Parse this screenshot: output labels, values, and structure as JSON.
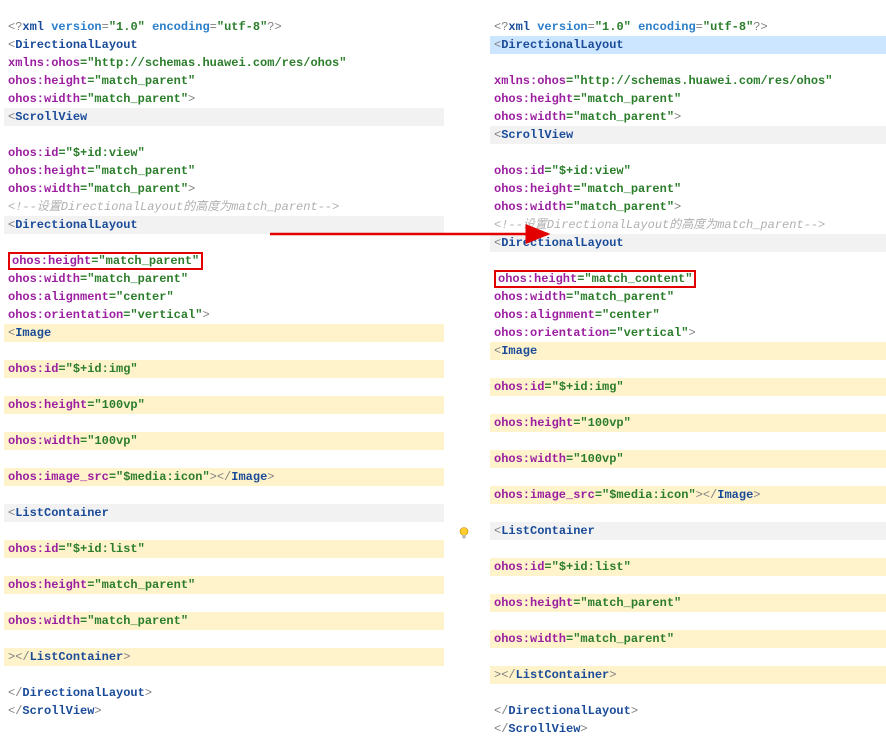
{
  "left": {
    "xml_decl": {
      "p1": "<?",
      "kw": "xml",
      "a1": "version",
      "v1": "\"1.0\"",
      "a2": "encoding",
      "v2": "\"utf-8\"",
      "p2": "?>"
    },
    "dl_open": {
      "lt": "<",
      "name": "DirectionalLayout"
    },
    "xmlns": {
      "a": "xmlns:ohos",
      "eq": "=",
      "v": "\"http://schemas.huawei.com/res/ohos\""
    },
    "height": {
      "a": "ohos:height",
      "eq": "=",
      "v": "\"match_parent\""
    },
    "width": {
      "a": "ohos:width",
      "eq": "=",
      "v": "\"match_parent\"",
      "gt": ">"
    },
    "sv_open": {
      "lt": "<",
      "name": "ScrollView"
    },
    "sv_id": {
      "a": "ohos:id",
      "eq": "=",
      "v": "\"$+id:view\""
    },
    "sv_h": {
      "a": "ohos:height",
      "eq": "=",
      "v": "\"match_parent\""
    },
    "sv_w": {
      "a": "ohos:width",
      "eq": "=",
      "v": "\"match_parent\"",
      "gt": ">"
    },
    "comment": "<!--设置DirectionalLayout的高度为match_parent-->",
    "dl2_open": {
      "lt": "<",
      "name": "DirectionalLayout"
    },
    "dl2_h_boxed": {
      "a": "ohos:height",
      "eq": "=",
      "v": "\"match_parent\""
    },
    "dl2_w": {
      "a": "ohos:width",
      "eq": "=",
      "v": "\"match_parent\""
    },
    "dl2_align": {
      "a": "ohos:alignment",
      "eq": "=",
      "v": "\"center\""
    },
    "dl2_orient": {
      "a": "ohos:orientation",
      "eq": "=",
      "v": "\"vertical\"",
      "gt": ">"
    },
    "img_open": {
      "lt": "<",
      "name": "Image"
    },
    "img_id": {
      "a": "ohos:id",
      "eq": "=",
      "v": "\"$+id:img\""
    },
    "img_h": {
      "a": "ohos:height",
      "eq": "=",
      "v": "\"100vp\""
    },
    "img_w": {
      "a": "ohos:width",
      "eq": "=",
      "v": "\"100vp\""
    },
    "img_src": {
      "a": "ohos:image_src",
      "eq": "=",
      "v": "\"$media:icon\"",
      "gt": ">",
      "close_lt": "</",
      "close_name": "Image",
      "close_gt": ">"
    },
    "lc_open": {
      "lt": "<",
      "name": "ListContainer"
    },
    "lc_id": {
      "a": "ohos:id",
      "eq": "=",
      "v": "\"$+id:list\""
    },
    "lc_h": {
      "a": "ohos:height",
      "eq": "=",
      "v": "\"match_parent\""
    },
    "lc_w": {
      "a": "ohos:width",
      "eq": "=",
      "v": "\"match_parent\""
    },
    "lc_close": {
      "gt": ">",
      "close_lt": "</",
      "close_name": "ListContainer",
      "close_gt": ">"
    },
    "dl2_close": {
      "lt": "</",
      "name": "DirectionalLayout",
      "gt": ">"
    },
    "sv_close": {
      "lt": "</",
      "name": "ScrollView",
      "gt": ">"
    }
  },
  "right": {
    "xml_decl": {
      "p1": "<?",
      "kw": "xml",
      "a1": "version",
      "v1": "\"1.0\"",
      "a2": "encoding",
      "v2": "\"utf-8\"",
      "p2": "?>"
    },
    "dl_open": {
      "lt": "<",
      "name": "DirectionalLayout"
    },
    "xmlns": {
      "a": "xmlns:ohos",
      "eq": "=",
      "v": "\"http://schemas.huawei.com/res/ohos\""
    },
    "height": {
      "a": "ohos:height",
      "eq": "=",
      "v": "\"match_parent\""
    },
    "width": {
      "a": "ohos:width",
      "eq": "=",
      "v": "\"match_parent\"",
      "gt": ">"
    },
    "sv_open": {
      "lt": "<",
      "name": "ScrollView"
    },
    "sv_id": {
      "a": "ohos:id",
      "eq": "=",
      "v": "\"$+id:view\""
    },
    "sv_h": {
      "a": "ohos:height",
      "eq": "=",
      "v": "\"match_parent\""
    },
    "sv_w": {
      "a": "ohos:width",
      "eq": "=",
      "v": "\"match_parent\"",
      "gt": ">"
    },
    "comment": "<!--设置DirectionalLayout的高度为match_parent-->",
    "dl2_open": {
      "lt": "<",
      "name": "DirectionalLayout"
    },
    "dl2_h_boxed": {
      "a": "ohos:height",
      "eq": "=",
      "v": "\"match_content\""
    },
    "dl2_w": {
      "a": "ohos:width",
      "eq": "=",
      "v": "\"match_parent\""
    },
    "dl2_align": {
      "a": "ohos:alignment",
      "eq": "=",
      "v": "\"center\""
    },
    "dl2_orient": {
      "a": "ohos:orientation",
      "eq": "=",
      "v": "\"vertical\"",
      "gt": ">"
    },
    "img_open": {
      "lt": "<",
      "name": "Image"
    },
    "img_id": {
      "a": "ohos:id",
      "eq": "=",
      "v": "\"$+id:img\""
    },
    "img_h": {
      "a": "ohos:height",
      "eq": "=",
      "v": "\"100vp\""
    },
    "img_w": {
      "a": "ohos:width",
      "eq": "=",
      "v": "\"100vp\""
    },
    "img_src": {
      "a": "ohos:image_src",
      "eq": "=",
      "v": "\"$media:icon\"",
      "gt": ">",
      "close_lt": "</",
      "close_name": "Image",
      "close_gt": ">"
    },
    "lc_open": {
      "lt": "<",
      "name": "ListContainer"
    },
    "lc_id": {
      "a": "ohos:id",
      "eq": "=",
      "v": "\"$+id:list\""
    },
    "lc_h": {
      "a": "ohos:height",
      "eq": "=",
      "v": "\"match_parent\""
    },
    "lc_w": {
      "a": "ohos:width",
      "eq": "=",
      "v": "\"match_parent\""
    },
    "lc_close": {
      "gt": ">",
      "close_lt": "</",
      "close_name": "ListContainer",
      "close_gt": ">"
    },
    "dl2_close": {
      "lt": "</",
      "name": "DirectionalLayout",
      "gt": ">"
    },
    "sv_close": {
      "lt": "</",
      "name": "ScrollView",
      "gt": ">"
    }
  }
}
